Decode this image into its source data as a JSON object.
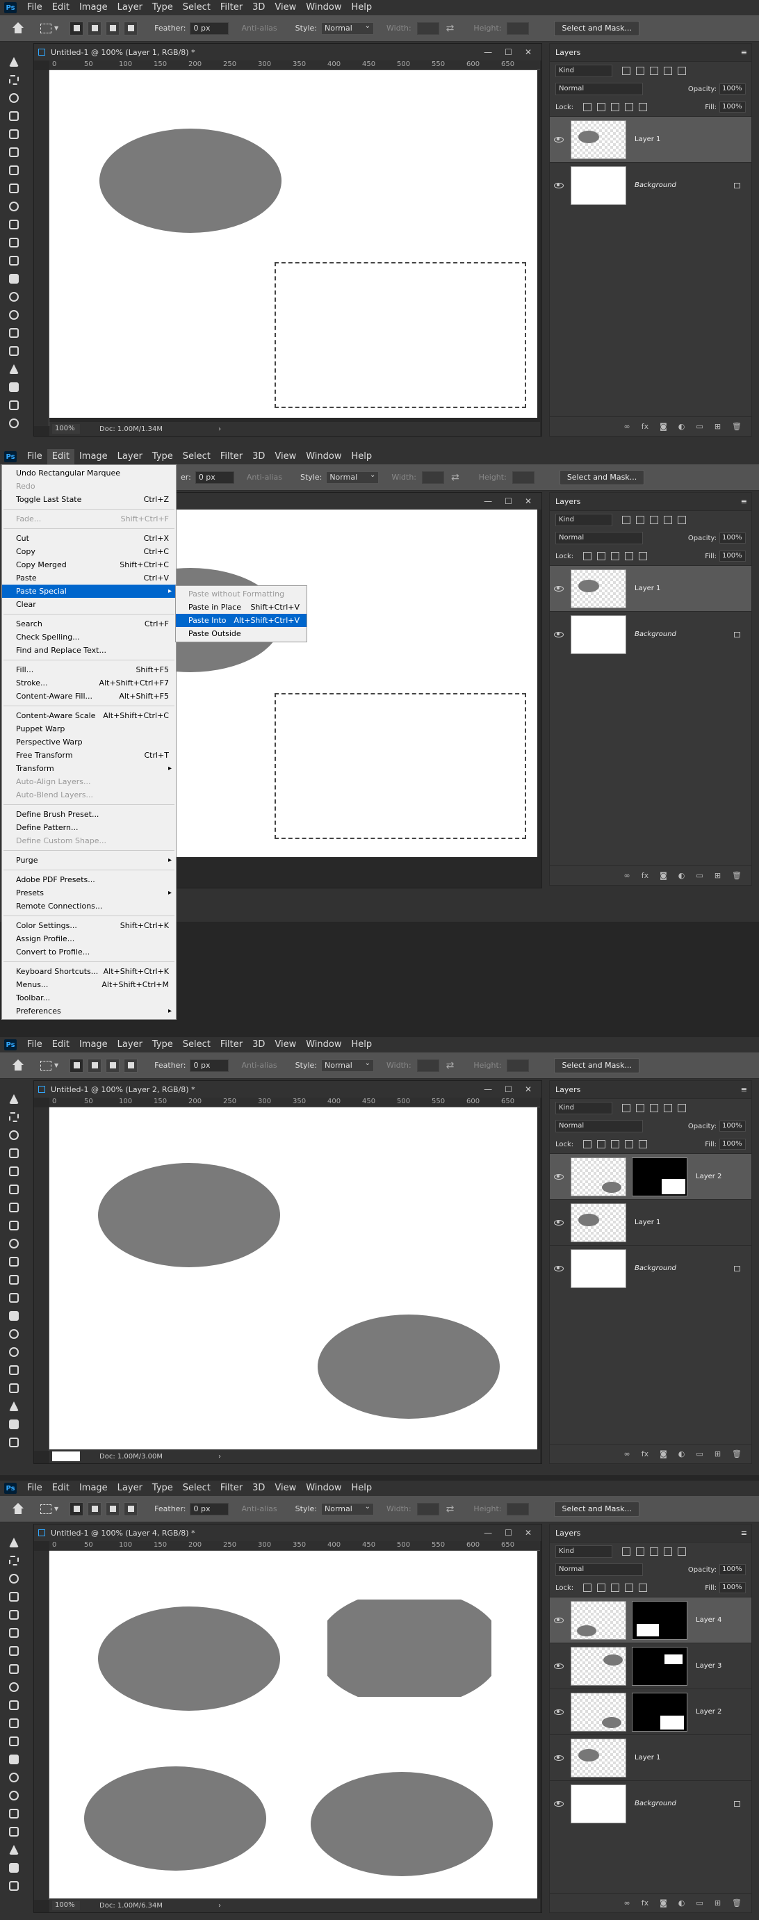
{
  "menubar": {
    "logo": "Ps",
    "items": [
      "File",
      "Edit",
      "Image",
      "Layer",
      "Type",
      "Select",
      "Filter",
      "3D",
      "View",
      "Window",
      "Help"
    ]
  },
  "options": {
    "feather_label": "Feather:",
    "feather_value": "0 px",
    "antialias_label": "Anti-alias",
    "style_label": "Style:",
    "style_value": "Normal",
    "width_label": "Width:",
    "height_label": "Height:",
    "mask_button": "Select and Mask..."
  },
  "layers_panel": {
    "title": "Layers",
    "kind": "Kind",
    "blend": "Normal",
    "opacity_label": "Opacity:",
    "opacity_value": "100%",
    "lock_label": "Lock:",
    "fill_label": "Fill:",
    "fill_value": "100%",
    "footer_icons": [
      "link-icon",
      "fx-icon",
      "mask-icon",
      "adjustment-icon",
      "folder-icon",
      "new-layer-icon",
      "trash-icon"
    ],
    "fx": "fx"
  },
  "ruler_ticks": [
    "0",
    "50",
    "100",
    "150",
    "200",
    "250",
    "300",
    "350",
    "400",
    "450",
    "500",
    "550",
    "600",
    "650"
  ],
  "window_controls": {
    "min": "—",
    "max": "☐",
    "close": "✕"
  },
  "panel1": {
    "doc_title": "Untitled-1 @ 100% (Layer 1, RGB/8) *",
    "zoom": "100%",
    "doc_info": "Doc: 1.00M/1.34M",
    "layers": [
      {
        "name": "Layer 1",
        "selected": true
      },
      {
        "name": "Background",
        "selected": false
      }
    ]
  },
  "panel2": {
    "edit_menu": [
      {
        "label": "Undo Rectangular Marquee",
        "shortcut": ""
      },
      {
        "label": "Redo",
        "shortcut": "",
        "disabled": true
      },
      {
        "label": "Toggle Last State",
        "shortcut": "Ctrl+Z"
      },
      {
        "sep": true
      },
      {
        "label": "Fade...",
        "shortcut": "Shift+Ctrl+F",
        "disabled": true
      },
      {
        "sep": true
      },
      {
        "label": "Cut",
        "shortcut": "Ctrl+X"
      },
      {
        "label": "Copy",
        "shortcut": "Ctrl+C"
      },
      {
        "label": "Copy Merged",
        "shortcut": "Shift+Ctrl+C"
      },
      {
        "label": "Paste",
        "shortcut": "Ctrl+V"
      },
      {
        "label": "Paste Special",
        "shortcut": "",
        "highlight": true,
        "sub": true
      },
      {
        "label": "Clear",
        "shortcut": ""
      },
      {
        "sep": true
      },
      {
        "label": "Search",
        "shortcut": "Ctrl+F"
      },
      {
        "label": "Check Spelling...",
        "shortcut": ""
      },
      {
        "label": "Find and Replace Text...",
        "shortcut": ""
      },
      {
        "sep": true
      },
      {
        "label": "Fill...",
        "shortcut": "Shift+F5"
      },
      {
        "label": "Stroke...",
        "shortcut": "Alt+Shift+Ctrl+F7"
      },
      {
        "label": "Content-Aware Fill...",
        "shortcut": "Alt+Shift+F5"
      },
      {
        "sep": true
      },
      {
        "label": "Content-Aware Scale",
        "shortcut": "Alt+Shift+Ctrl+C"
      },
      {
        "label": "Puppet Warp",
        "shortcut": ""
      },
      {
        "label": "Perspective Warp",
        "shortcut": ""
      },
      {
        "label": "Free Transform",
        "shortcut": "Ctrl+T"
      },
      {
        "label": "Transform",
        "shortcut": "",
        "sub": true
      },
      {
        "label": "Auto-Align Layers...",
        "shortcut": "",
        "disabled": true
      },
      {
        "label": "Auto-Blend Layers...",
        "shortcut": "",
        "disabled": true
      },
      {
        "sep": true
      },
      {
        "label": "Define Brush Preset...",
        "shortcut": ""
      },
      {
        "label": "Define Pattern...",
        "shortcut": ""
      },
      {
        "label": "Define Custom Shape...",
        "shortcut": "",
        "disabled": true
      },
      {
        "sep": true
      },
      {
        "label": "Purge",
        "shortcut": "",
        "sub": true
      },
      {
        "sep": true
      },
      {
        "label": "Adobe PDF Presets...",
        "shortcut": ""
      },
      {
        "label": "Presets",
        "shortcut": "",
        "sub": true
      },
      {
        "label": "Remote Connections...",
        "shortcut": ""
      },
      {
        "sep": true
      },
      {
        "label": "Color Settings...",
        "shortcut": "Shift+Ctrl+K"
      },
      {
        "label": "Assign Profile...",
        "shortcut": ""
      },
      {
        "label": "Convert to Profile...",
        "shortcut": ""
      },
      {
        "sep": true
      },
      {
        "label": "Keyboard Shortcuts...",
        "shortcut": "Alt+Shift+Ctrl+K"
      },
      {
        "label": "Menus...",
        "shortcut": "Alt+Shift+Ctrl+M"
      },
      {
        "label": "Toolbar...",
        "shortcut": ""
      },
      {
        "label": "Preferences",
        "shortcut": "",
        "sub": true
      }
    ],
    "submenu": [
      {
        "label": "Paste without Formatting",
        "shortcut": "",
        "disabled": true
      },
      {
        "label": "Paste in Place",
        "shortcut": "Shift+Ctrl+V"
      },
      {
        "label": "Paste Into",
        "shortcut": "Alt+Shift+Ctrl+V",
        "highlight": true
      },
      {
        "label": "Paste Outside",
        "shortcut": ""
      }
    ],
    "feather_fragment": "er:",
    "layers": [
      {
        "name": "Layer 1",
        "selected": true
      },
      {
        "name": "Background",
        "selected": false
      }
    ]
  },
  "panel3": {
    "doc_title": "Untitled-1 @ 100% (Layer 2, RGB/8) *",
    "doc_info": "Doc: 1.00M/3.00M",
    "layers": [
      {
        "name": "Layer 2",
        "selected": true
      },
      {
        "name": "Layer 1",
        "selected": false
      },
      {
        "name": "Background",
        "selected": false
      }
    ]
  },
  "panel4": {
    "doc_title": "Untitled-1 @ 100% (Layer 4, RGB/8) *",
    "zoom": "100%",
    "doc_info": "Doc: 1.00M/6.34M",
    "layers": [
      {
        "name": "Layer 4",
        "selected": true
      },
      {
        "name": "Layer 3",
        "selected": false
      },
      {
        "name": "Layer 2",
        "selected": false
      },
      {
        "name": "Layer 1",
        "selected": false
      },
      {
        "name": "Background",
        "selected": false
      }
    ]
  }
}
